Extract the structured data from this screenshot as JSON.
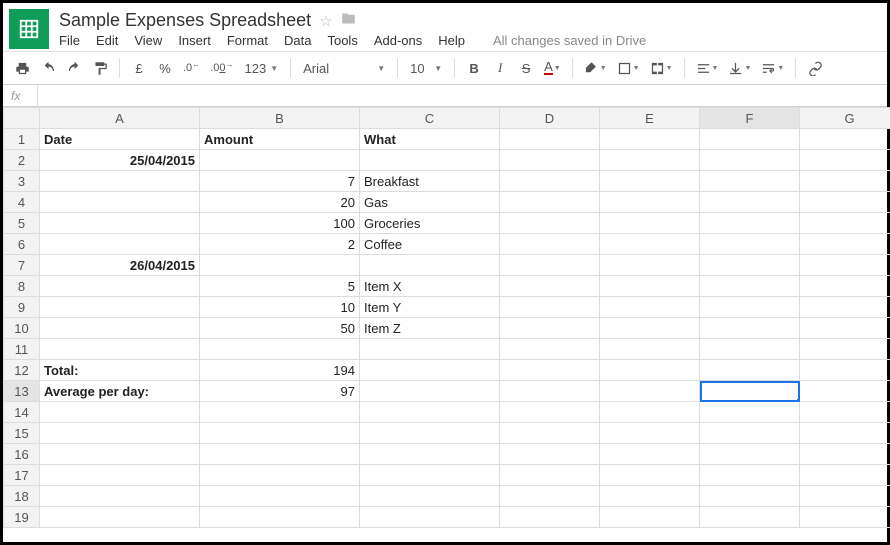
{
  "doc": {
    "title": "Sample Expenses Spreadsheet"
  },
  "menu": {
    "file": "File",
    "edit": "Edit",
    "view": "View",
    "insert": "Insert",
    "format": "Format",
    "data": "Data",
    "tools": "Tools",
    "addons": "Add-ons",
    "help": "Help",
    "status": "All changes saved in Drive"
  },
  "toolbar": {
    "currency": "£",
    "percent": "%",
    "dec_dec": ".0",
    "inc_dec": ".00",
    "more_formats": "123",
    "font": "Arial",
    "size": "10",
    "bold": "B",
    "italic": "I",
    "strike": "S",
    "textcolor": "A"
  },
  "fx": {
    "label": "fx"
  },
  "columns": [
    "A",
    "B",
    "C",
    "D",
    "E",
    "F",
    "G"
  ],
  "rows": [
    {
      "n": 1,
      "A": "Date",
      "A_cls": "bold la",
      "B": "Amount",
      "B_cls": "bold la",
      "C": "What",
      "C_cls": "bold la"
    },
    {
      "n": 2,
      "A": "25/04/2015",
      "A_cls": "bold ra"
    },
    {
      "n": 3,
      "B": "7",
      "B_cls": "ra",
      "C": "Breakfast",
      "C_cls": "la"
    },
    {
      "n": 4,
      "B": "20",
      "B_cls": "ra",
      "C": "Gas",
      "C_cls": "la"
    },
    {
      "n": 5,
      "B": "100",
      "B_cls": "ra",
      "C": "Groceries",
      "C_cls": "la"
    },
    {
      "n": 6,
      "B": "2",
      "B_cls": "ra",
      "C": "Coffee",
      "C_cls": "la"
    },
    {
      "n": 7,
      "A": "26/04/2015",
      "A_cls": "bold ra"
    },
    {
      "n": 8,
      "B": "5",
      "B_cls": "ra",
      "C": "Item X",
      "C_cls": "la"
    },
    {
      "n": 9,
      "B": "10",
      "B_cls": "ra",
      "C": "Item Y",
      "C_cls": "la"
    },
    {
      "n": 10,
      "B": "50",
      "B_cls": "ra",
      "C": "Item Z",
      "C_cls": "la"
    },
    {
      "n": 11
    },
    {
      "n": 12,
      "A": "Total:",
      "A_cls": "bold la",
      "B": "194",
      "B_cls": "ra"
    },
    {
      "n": 13,
      "A": "Average per day:",
      "A_cls": "bold la",
      "B": "97",
      "B_cls": "ra",
      "sel": "F"
    },
    {
      "n": 14
    },
    {
      "n": 15
    },
    {
      "n": 16
    },
    {
      "n": 17
    },
    {
      "n": 18
    },
    {
      "n": 19
    }
  ]
}
